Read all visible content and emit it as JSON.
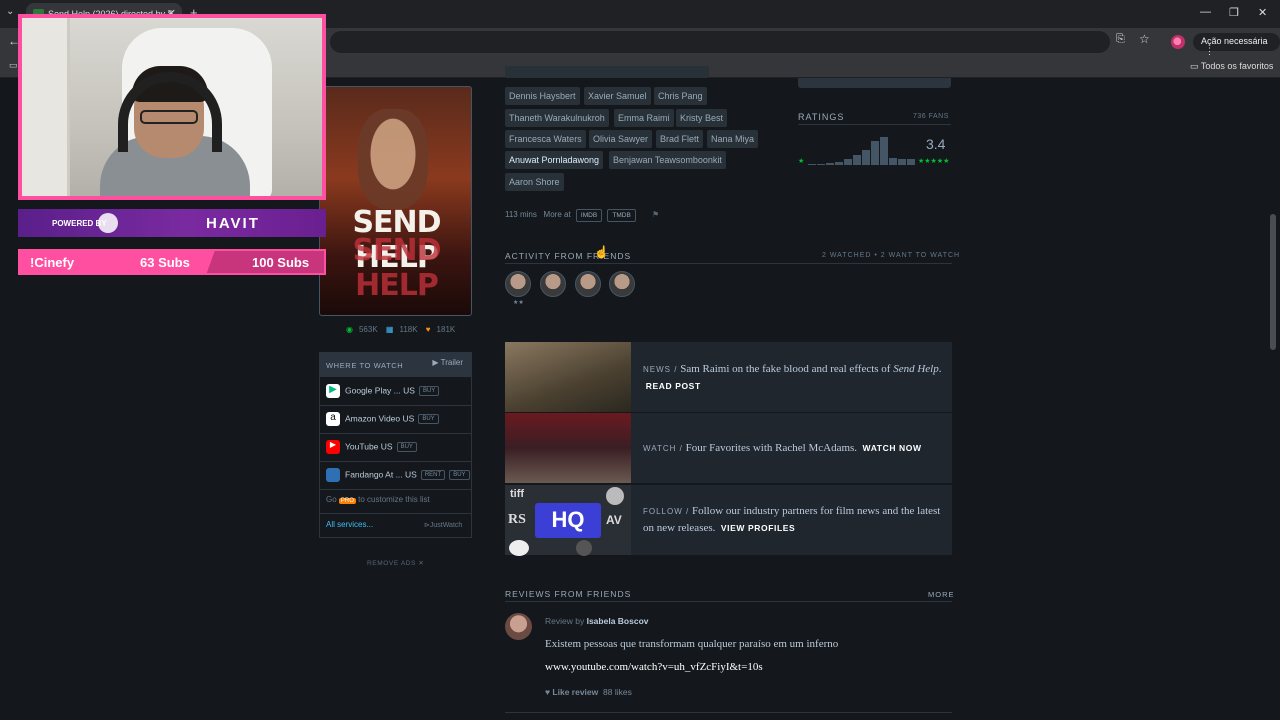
{
  "browser": {
    "tab_title": "Send Help (2026) directed by S...",
    "action_label": "Ação necessária",
    "bookmarks_label": "Todos os favoritos"
  },
  "overlay": {
    "sponsor_powered": "POWERED BY",
    "sponsor_brand": "HAVIT",
    "command": "!Cinefy",
    "subs_current": "63 Subs",
    "subs_goal": "100 Subs"
  },
  "film": {
    "poster_title": "SEND HELP",
    "stats": {
      "watched": "563K",
      "lists": "118K",
      "likes": "181K"
    },
    "cast": [
      "Dennis Haysbert",
      "Xavier Samuel",
      "Chris Pang",
      "Thaneth Warakulnukroh",
      "Emma Raimi",
      "Kristy Best",
      "Francesca Waters",
      "Olivia Sawyer",
      "Brad Flett",
      "Nana Miya",
      "Anuwat Pornladawong",
      "Benjawan Teawsomboonkit",
      "Aaron Shore"
    ],
    "runtime": "113 mins",
    "more_at": "More at",
    "imdb": "IMDB",
    "tmdb": "TMDB"
  },
  "ratings": {
    "header": "RATINGS",
    "fans": "736 FANS",
    "average": "3.4",
    "min_star": "★",
    "max_star": "★★★★★",
    "histogram": [
      0.05,
      0.05,
      0.08,
      0.12,
      0.2,
      0.35,
      0.55,
      0.85,
      1.0,
      0.25,
      0.2,
      0.2
    ]
  },
  "watch": {
    "header": "WHERE TO WATCH",
    "trailer": "Trailer",
    "services": [
      {
        "name": "Google Play ...",
        "region": "US",
        "pills": [
          "BUY"
        ],
        "icon": "google-play-icon",
        "color": "#ffffff"
      },
      {
        "name": "Amazon Video",
        "region": "US",
        "pills": [
          "BUY"
        ],
        "icon": "amazon-icon",
        "color": "#ffffff"
      },
      {
        "name": "YouTube",
        "region": "US",
        "pills": [
          "BUY"
        ],
        "icon": "youtube-icon",
        "color": "#ff0000"
      },
      {
        "name": "Fandango At ...",
        "region": "US",
        "pills": [
          "RENT",
          "BUY"
        ],
        "icon": "fandango-icon",
        "color": "#2f6fb3"
      }
    ],
    "go_pro_pre": "Go",
    "pro_badge": "PRO",
    "go_pro_post": "to customize this list",
    "all_services": "All services...",
    "justwatch": "JustWatch",
    "remove_ads": "REMOVE ADS ✕"
  },
  "activity": {
    "header": "ACTIVITY FROM FRIENDS",
    "summary": "2 WATCHED • 2 WANT TO WATCH",
    "first_rating": "★★"
  },
  "promos": [
    {
      "tag": "NEWS /",
      "text": "Sam Raimi on the fake blood and real effects of",
      "italic": "Send Help",
      "end": ".",
      "cta": "READ POST"
    },
    {
      "tag": "WATCH /",
      "text": "Four Favorites with Rachel McAdams.",
      "cta": "WATCH NOW"
    },
    {
      "tag": "FOLLOW /",
      "text": "Follow our industry partners for film news and the latest on new releases.",
      "cta": "VIEW PROFILES"
    }
  ],
  "partner_logos": [
    "tiff",
    "AV",
    "HQ",
    "RS"
  ],
  "reviews": {
    "header": "REVIEWS FROM FRIENDS",
    "more": "MORE",
    "review_by": "Review by",
    "author": "Isabela Boscov",
    "text": "Existem pessoas que transformam qualquer paraíso em um inferno",
    "link": "www.youtube.com/watch?v=uh_vfZcFiyI&t=10s",
    "like_label": "Like review",
    "likes": "88 likes"
  }
}
